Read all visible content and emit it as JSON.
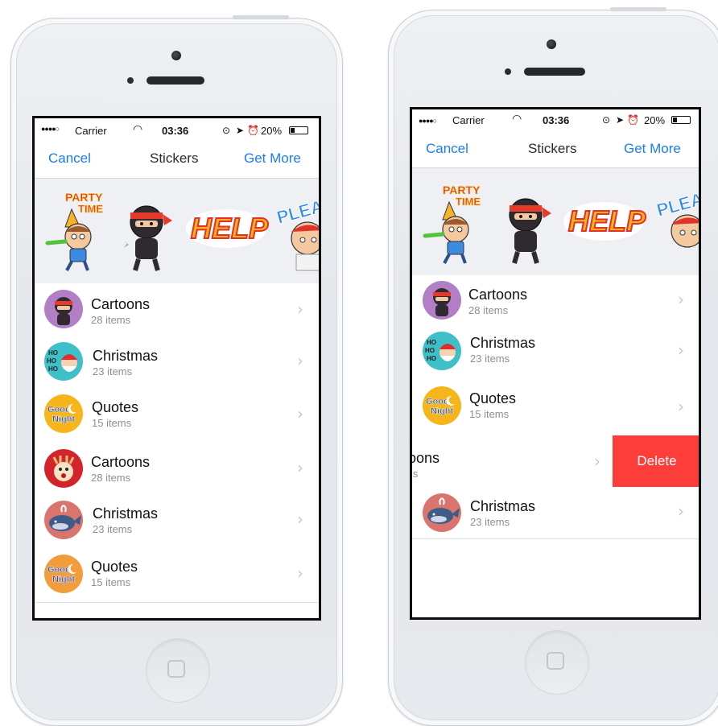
{
  "status": {
    "carrier": "Carrier",
    "time": "03:36",
    "battery": "20%"
  },
  "nav": {
    "cancel": "Cancel",
    "title": "Stickers",
    "get_more": "Get More"
  },
  "stickers": {
    "party_line1": "PARTY",
    "party_line2": "TIME",
    "help": "HELP",
    "please": "PLEA"
  },
  "avatar_text": {
    "ho": "HO",
    "good": "Good",
    "night": "Night"
  },
  "screen1": {
    "items": [
      {
        "name": "Cartoons",
        "count": "28 items",
        "icon": "ninja-avatar-icon",
        "color": "#b27fc7"
      },
      {
        "name": "Christmas",
        "count": "23 items",
        "icon": "santa-avatar-icon",
        "color": "#3fc0c8"
      },
      {
        "name": "Quotes",
        "count": "15 items",
        "icon": "good-night-avatar-icon",
        "color": "#f5b51b"
      },
      {
        "name": "Cartoons",
        "count": "28 items",
        "icon": "reindeer-avatar-icon",
        "color": "#d3242b"
      },
      {
        "name": "Christmas",
        "count": "23 items",
        "icon": "whale-avatar-icon",
        "color": "#d9746e"
      },
      {
        "name": "Quotes",
        "count": "15 items",
        "icon": "good-night-avatar-icon",
        "color": "#f39c3b"
      }
    ]
  },
  "screen2": {
    "items": [
      {
        "name": "Cartoons",
        "count": "28 items"
      },
      {
        "name": "Christmas",
        "count": "23 items"
      },
      {
        "name": "Quotes",
        "count": "15 items"
      },
      {
        "name": "toons",
        "count": "ms"
      },
      {
        "name": "Christmas",
        "count": "23 items"
      }
    ],
    "delete_label": "Delete"
  },
  "colors": {
    "accent": "#1a7df5",
    "delete": "#fc3d39"
  }
}
